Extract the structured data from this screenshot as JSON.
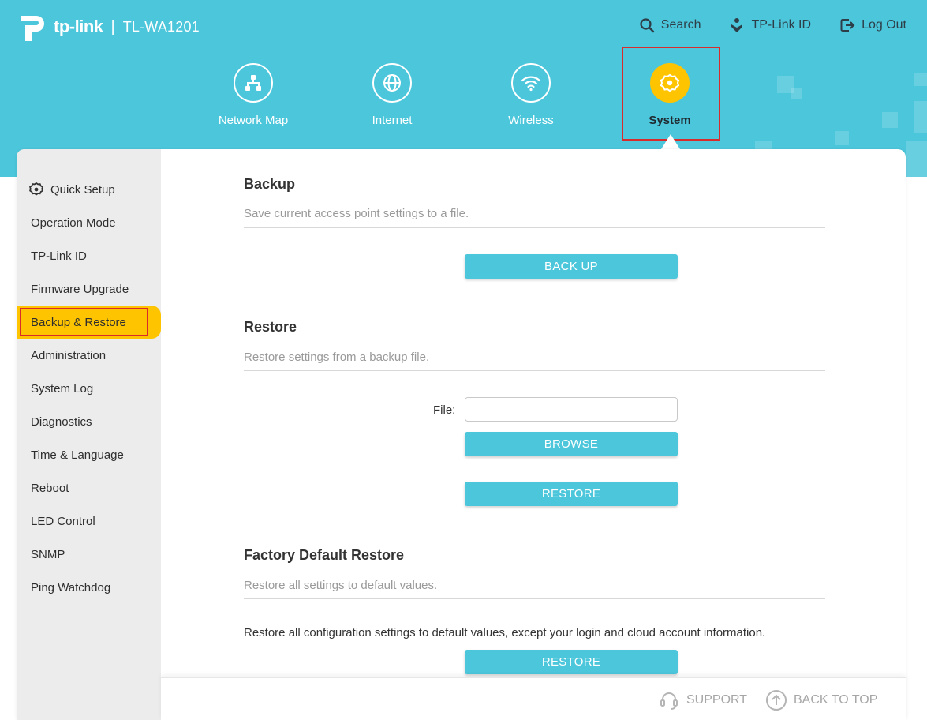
{
  "header": {
    "brand": "tp-link",
    "separator": "|",
    "model": "TL-WA1201",
    "links": {
      "search": "Search",
      "tplink_id": "TP-Link ID",
      "logout": "Log Out"
    }
  },
  "main_nav": {
    "network_map": "Network Map",
    "internet": "Internet",
    "wireless": "Wireless",
    "system": "System",
    "active": "System"
  },
  "sidebar": {
    "active": "Backup & Restore",
    "items": [
      {
        "label": "Quick Setup",
        "icon": "gear-icon"
      },
      {
        "label": "Operation Mode"
      },
      {
        "label": "TP-Link ID"
      },
      {
        "label": "Firmware Upgrade"
      },
      {
        "label": "Backup & Restore"
      },
      {
        "label": "Administration"
      },
      {
        "label": "System Log"
      },
      {
        "label": "Diagnostics"
      },
      {
        "label": "Time & Language"
      },
      {
        "label": "Reboot"
      },
      {
        "label": "LED Control"
      },
      {
        "label": "SNMP"
      },
      {
        "label": "Ping Watchdog"
      }
    ]
  },
  "backup": {
    "title": "Backup",
    "description": "Save current access point settings to a file.",
    "button": "BACK UP"
  },
  "restore": {
    "title": "Restore",
    "description": "Restore settings from a backup file.",
    "file_label": "File:",
    "file_value": "",
    "browse_button": "BROWSE",
    "restore_button": "RESTORE"
  },
  "factory": {
    "title": "Factory Default Restore",
    "description": "Restore all settings to default values.",
    "note": "Restore all configuration settings to default values, except your login and cloud account information.",
    "button": "RESTORE"
  },
  "footer": {
    "support": "SUPPORT",
    "back_to_top": "BACK TO TOP"
  },
  "colors": {
    "header_bg": "#4cc6db",
    "accent": "#ffc400",
    "button": "#4cc6db",
    "highlight_border": "#d92b2b"
  }
}
